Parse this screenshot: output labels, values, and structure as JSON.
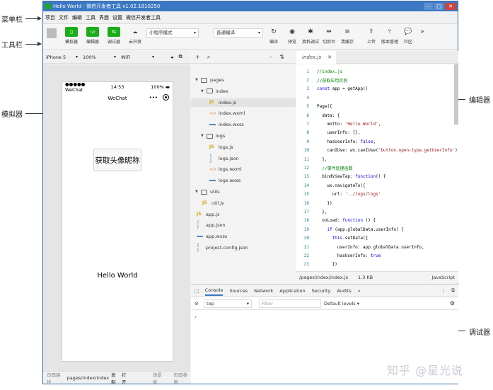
{
  "annotations": {
    "menubar": "菜单栏",
    "toolbar": "工具栏",
    "simulator": "模拟器",
    "editor": "编辑器",
    "debugger": "调试器"
  },
  "window": {
    "title": "Hello World - 微信开发者工具 v1.02.1810250"
  },
  "menu": [
    "项目",
    "文件",
    "编辑",
    "工具",
    "界面",
    "设置",
    "微信开发者工具"
  ],
  "toolbar": {
    "simulator": "模拟器",
    "editor": "编辑器",
    "debugger": "调试器",
    "cloud": "云开发",
    "mode": "小程序模式",
    "compile_mode": "普通编译",
    "compile": "编译",
    "preview": "预览",
    "real_debug": "真机调试",
    "backstage": "切后台",
    "cache": "清缓存",
    "upload": "上传",
    "version": "版本管理",
    "community": "社区"
  },
  "simulator": {
    "device": "iPhone 5",
    "zoom": "100%",
    "network": "WiFi",
    "status_signal": "●●●●● WeChat",
    "status_time": "14:53",
    "status_battery": "100%",
    "nav_title": "WeChat",
    "button_label": "获取头像昵称",
    "hello_text": "Hello World",
    "footer": {
      "path_label": "页面路径",
      "path": "pages/index/index",
      "copy": "复制",
      "open": "打开",
      "scene": "场景值",
      "params": "页面参数"
    }
  },
  "tree": [
    {
      "name": "pages",
      "type": "folder",
      "depth": 0
    },
    {
      "name": "index",
      "type": "folder",
      "depth": 1
    },
    {
      "name": "index.js",
      "type": "js",
      "depth": 2,
      "selected": true
    },
    {
      "name": "index.wxml",
      "type": "wxml",
      "depth": 2
    },
    {
      "name": "index.wxss",
      "type": "wxss",
      "depth": 2
    },
    {
      "name": "logs",
      "type": "folder",
      "depth": 1
    },
    {
      "name": "logs.js",
      "type": "js",
      "depth": 2
    },
    {
      "name": "logs.json",
      "type": "json",
      "depth": 2
    },
    {
      "name": "logs.wxml",
      "type": "wxml",
      "depth": 2
    },
    {
      "name": "logs.wxss",
      "type": "wxss",
      "depth": 2
    },
    {
      "name": "utils",
      "type": "folder",
      "depth": 0
    },
    {
      "name": "util.js",
      "type": "js",
      "depth": 1
    },
    {
      "name": "app.js",
      "type": "js",
      "depth": 0
    },
    {
      "name": "app.json",
      "type": "json",
      "depth": 0
    },
    {
      "name": "app.wxss",
      "type": "wxss",
      "depth": 0
    },
    {
      "name": "project.config.json",
      "type": "json",
      "depth": 0
    }
  ],
  "editor": {
    "tab": "index.js",
    "lines": [
      "//index.js",
      "//获取应用实例",
      "const app = getApp()",
      "",
      "Page({",
      "  data: {",
      "    motto: 'Hello World',",
      "    userInfo: {},",
      "    hasUserInfo: false,",
      "    canIUse: wx.canIUse('button.open-type.getUserInfo')",
      "  },",
      "  //事件处理函数",
      "  bindViewTap: function() {",
      "    wx.navigateTo({",
      "      url: '../logs/logs'",
      "    })",
      "  },",
      "  onLoad: function () {",
      "    if (app.globalData.userInfo) {",
      "      this.setData({",
      "        userInfo: app.globalData.userInfo,",
      "        hasUserInfo: true",
      "      })"
    ],
    "status_path": "/pages/index/index.js",
    "status_size": "1.3 KB",
    "status_lang": "JavaScript"
  },
  "debugger": {
    "tabs": [
      "Console",
      "Sources",
      "Network",
      "Application",
      "Security",
      "Audits"
    ],
    "context": "top",
    "filter_placeholder": "Filter",
    "levels": "Default levels"
  },
  "watermark": "知乎 @星光说"
}
